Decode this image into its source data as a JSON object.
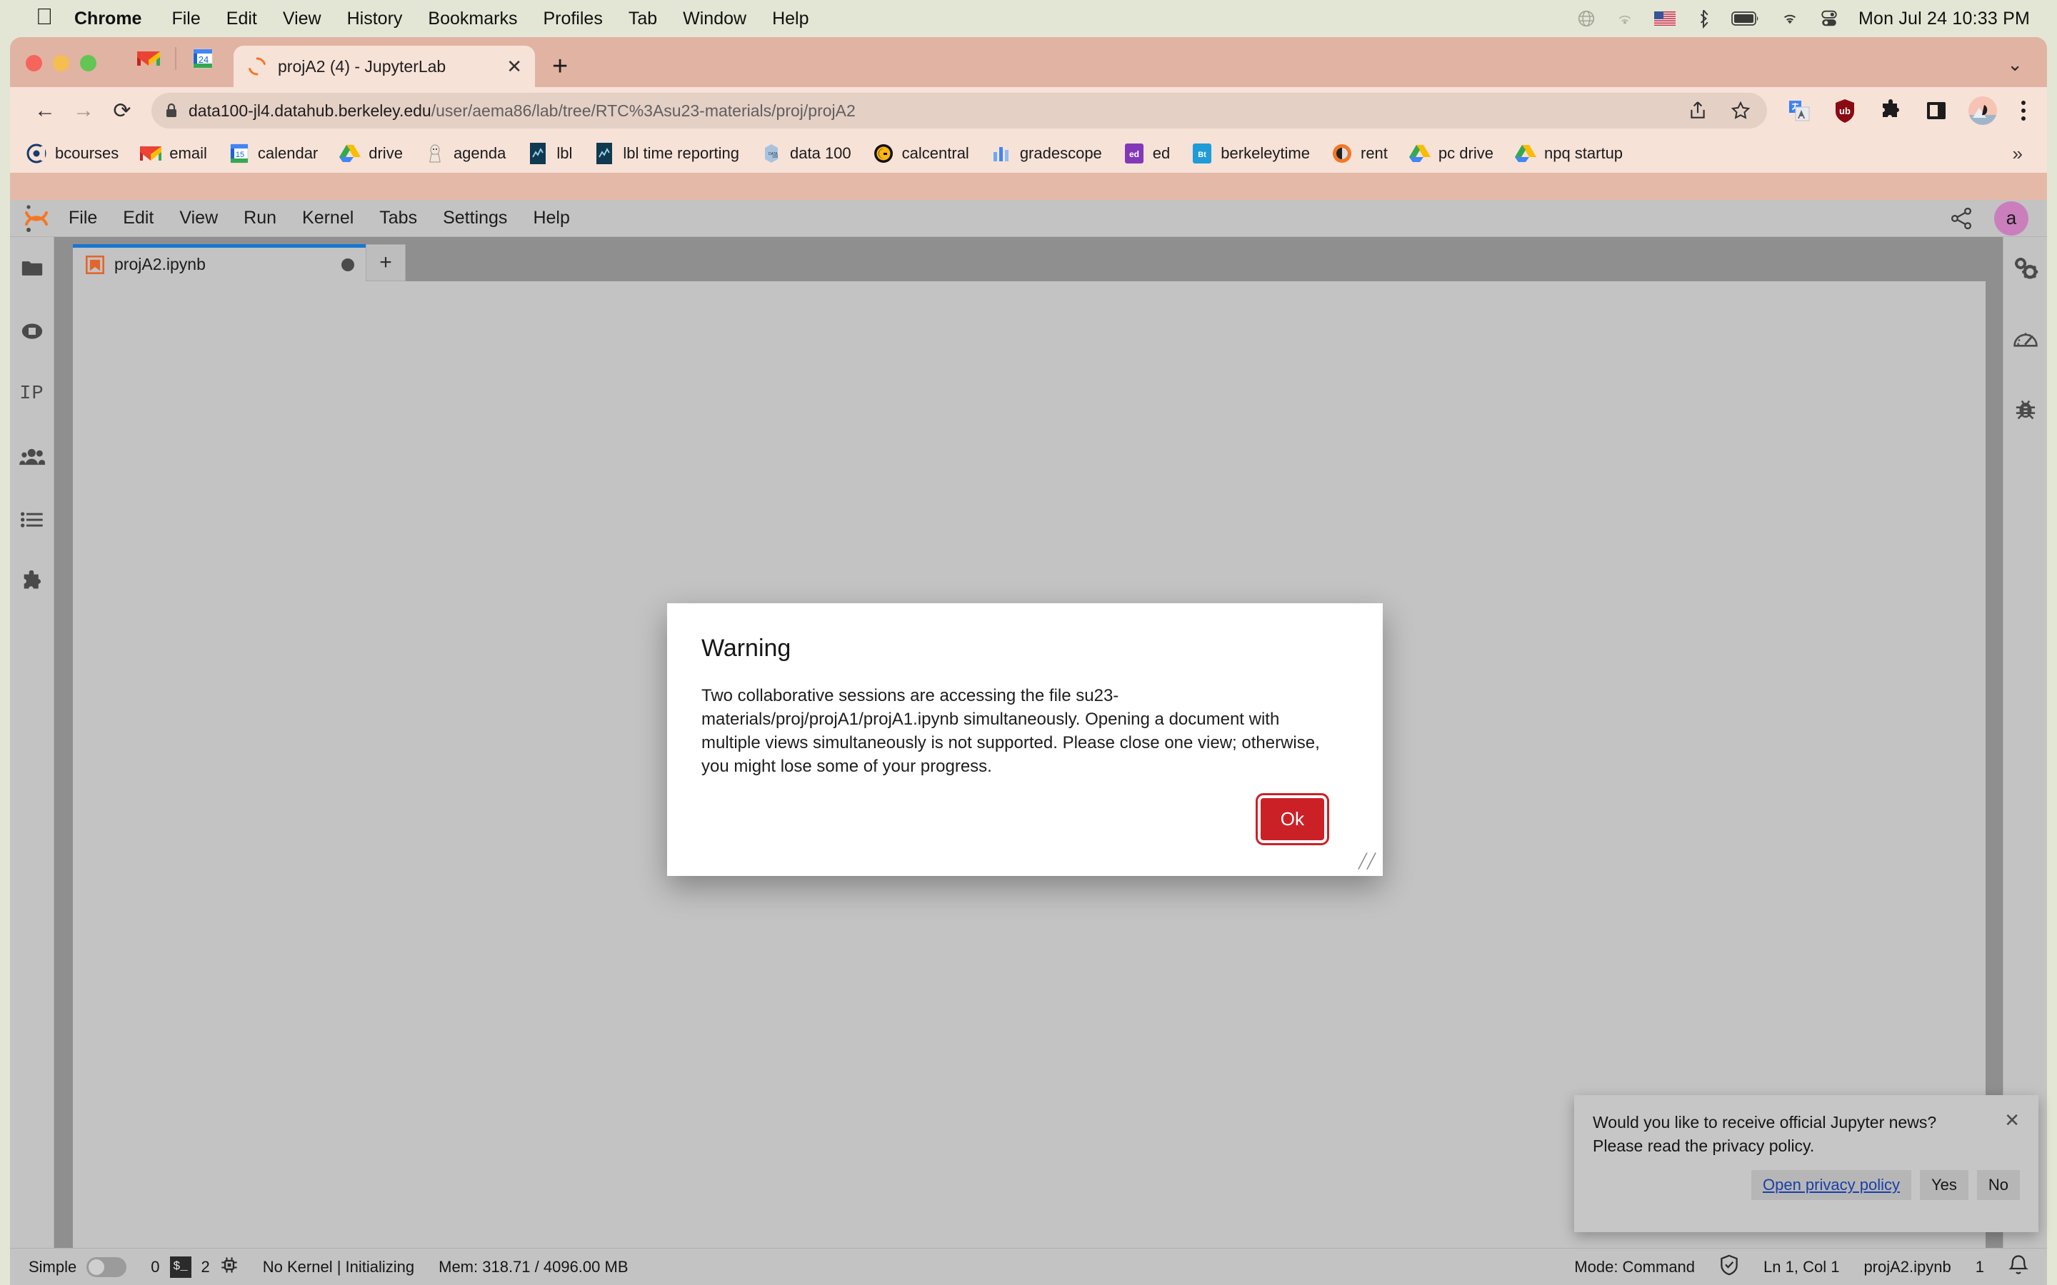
{
  "macos": {
    "apple_icon": "apple-logo-icon",
    "menus": [
      "Chrome",
      "File",
      "Edit",
      "View",
      "History",
      "Bookmarks",
      "Profiles",
      "Tab",
      "Window",
      "Help"
    ],
    "status_icons": [
      "globe-icon",
      "airplay-icon",
      "us-flag-icon",
      "bluetooth-icon",
      "battery-icon",
      "wifi-icon",
      "control-center-icon"
    ],
    "clock": "Mon Jul 24  10:33 PM"
  },
  "chrome": {
    "pinned_tabs": [
      {
        "name": "gmail-pinned-tab",
        "icon": "gmail-icon"
      },
      {
        "name": "calendar-pinned-tab",
        "icon": "calendar-24-icon"
      }
    ],
    "tab": {
      "title": "projA2 (4) - JupyterLab",
      "favicon": "jupyter-loading-icon",
      "close_label": "✕",
      "new_tab_label": "+",
      "tablist_chevron": "⌄"
    },
    "nav": {
      "back": "←",
      "forward": "→",
      "reload": "⟳"
    },
    "omnibox": {
      "lock_icon": "lock-icon",
      "domain": "data100-jl4.datahub.berkeley.edu",
      "path": "/user/aema86/lab/tree/RTC%3Asu23-materials/proj/projA2",
      "share_icon": "share-icon",
      "bookmark_icon": "star-icon"
    },
    "extensions": [
      "google-translate-icon",
      "ublock-origin-icon",
      "puzzle-extensions-icon",
      "side-panel-icon",
      "profile-avatar-icon",
      "kebab-menu-icon"
    ],
    "bookmarks": [
      {
        "label": "bcourses",
        "icon": "bcourses-icon"
      },
      {
        "label": "email",
        "icon": "gmail-icon"
      },
      {
        "label": "calendar",
        "icon": "calendar-15-icon"
      },
      {
        "label": "drive",
        "icon": "google-drive-icon"
      },
      {
        "label": "agenda",
        "icon": "agenda-icon"
      },
      {
        "label": "lbl",
        "icon": "lbl-icon"
      },
      {
        "label": "lbl time reporting",
        "icon": "lbl-icon"
      },
      {
        "label": "data 100",
        "icon": "data100-icon"
      },
      {
        "label": "calcentral",
        "icon": "calcentral-icon"
      },
      {
        "label": "gradescope",
        "icon": "gradescope-icon"
      },
      {
        "label": "ed",
        "icon": "ed-icon"
      },
      {
        "label": "berkeleytime",
        "icon": "berkeleytime-icon"
      },
      {
        "label": "rent",
        "icon": "rent-icon"
      },
      {
        "label": "pc drive",
        "icon": "google-drive-icon"
      },
      {
        "label": "npq startup",
        "icon": "google-drive-icon"
      }
    ],
    "bookmarks_overflow": "»"
  },
  "jupyterlab": {
    "logo": "jupyter-logo-icon",
    "menus": [
      "File",
      "Edit",
      "View",
      "Run",
      "Kernel",
      "Tabs",
      "Settings",
      "Help"
    ],
    "share_icon": "share-nodes-icon",
    "avatar_initial": "a",
    "left_sidebar": [
      {
        "name": "file-browser-icon",
        "glyph": "folder"
      },
      {
        "name": "running-terminals-icon",
        "glyph": "stop"
      },
      {
        "name": "ipython-kernel-icon",
        "glyph": "IP"
      },
      {
        "name": "collaboration-icon",
        "glyph": "people"
      },
      {
        "name": "table-of-contents-icon",
        "glyph": "list"
      },
      {
        "name": "extension-manager-icon",
        "glyph": "puzzle"
      }
    ],
    "right_sidebar": [
      {
        "name": "property-inspector-icon",
        "glyph": "gears"
      },
      {
        "name": "performance-icon",
        "glyph": "gauge"
      },
      {
        "name": "debugger-icon",
        "glyph": "bug"
      }
    ],
    "document_tab": {
      "label": "projA2.ipynb",
      "icon": "notebook-icon",
      "dirty_indicator": "unsaved-dot",
      "add_tab_label": "+"
    },
    "status_bar": {
      "simple_label": "Simple",
      "simple_toggle_on": false,
      "terminal_count": "0",
      "terminal_icon": "terminal-icon",
      "kernel_count": "2",
      "kernel_icon": "kernel-chip-icon",
      "kernel_status": "No Kernel | Initializing",
      "memory": "Mem: 318.71 / 4096.00 MB",
      "mode": "Mode: Command",
      "trust_icon": "trusted-shield-icon",
      "cursor_position": "Ln 1, Col 1",
      "file_name": "projA2.ipynb",
      "notification_count": "1",
      "notification_icon": "bell-icon"
    }
  },
  "warning_dialog": {
    "title": "Warning",
    "message": "Two collaborative sessions are accessing the file su23-materials/proj/projA1/projA1.ipynb simultaneously. Opening a document with multiple views simultaneously is not supported. Please close one view; otherwise, you might lose some of your progress.",
    "ok_label": "Ok",
    "accent_color": "#cc2027",
    "resize_handle": "╱╱"
  },
  "news_toast": {
    "line1": "Would you like to receive official Jupyter news?",
    "line2": "Please read the privacy policy.",
    "close_label": "✕",
    "link_label": "Open privacy policy",
    "yes_label": "Yes",
    "no_label": "No"
  }
}
